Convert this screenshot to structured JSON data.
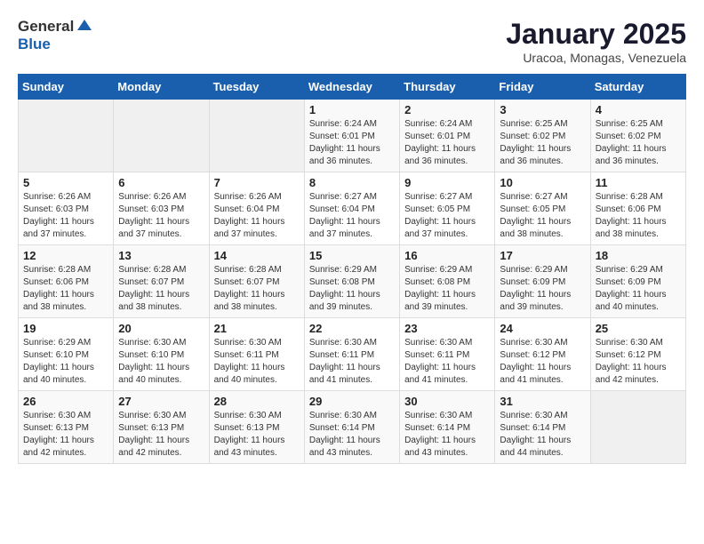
{
  "header": {
    "logo_general": "General",
    "logo_blue": "Blue",
    "month": "January 2025",
    "location": "Uracoa, Monagas, Venezuela"
  },
  "days_of_week": [
    "Sunday",
    "Monday",
    "Tuesday",
    "Wednesday",
    "Thursday",
    "Friday",
    "Saturday"
  ],
  "weeks": [
    [
      {
        "day": "",
        "info": ""
      },
      {
        "day": "",
        "info": ""
      },
      {
        "day": "",
        "info": ""
      },
      {
        "day": "1",
        "info": "Sunrise: 6:24 AM\nSunset: 6:01 PM\nDaylight: 11 hours\nand 36 minutes."
      },
      {
        "day": "2",
        "info": "Sunrise: 6:24 AM\nSunset: 6:01 PM\nDaylight: 11 hours\nand 36 minutes."
      },
      {
        "day": "3",
        "info": "Sunrise: 6:25 AM\nSunset: 6:02 PM\nDaylight: 11 hours\nand 36 minutes."
      },
      {
        "day": "4",
        "info": "Sunrise: 6:25 AM\nSunset: 6:02 PM\nDaylight: 11 hours\nand 36 minutes."
      }
    ],
    [
      {
        "day": "5",
        "info": "Sunrise: 6:26 AM\nSunset: 6:03 PM\nDaylight: 11 hours\nand 37 minutes."
      },
      {
        "day": "6",
        "info": "Sunrise: 6:26 AM\nSunset: 6:03 PM\nDaylight: 11 hours\nand 37 minutes."
      },
      {
        "day": "7",
        "info": "Sunrise: 6:26 AM\nSunset: 6:04 PM\nDaylight: 11 hours\nand 37 minutes."
      },
      {
        "day": "8",
        "info": "Sunrise: 6:27 AM\nSunset: 6:04 PM\nDaylight: 11 hours\nand 37 minutes."
      },
      {
        "day": "9",
        "info": "Sunrise: 6:27 AM\nSunset: 6:05 PM\nDaylight: 11 hours\nand 37 minutes."
      },
      {
        "day": "10",
        "info": "Sunrise: 6:27 AM\nSunset: 6:05 PM\nDaylight: 11 hours\nand 38 minutes."
      },
      {
        "day": "11",
        "info": "Sunrise: 6:28 AM\nSunset: 6:06 PM\nDaylight: 11 hours\nand 38 minutes."
      }
    ],
    [
      {
        "day": "12",
        "info": "Sunrise: 6:28 AM\nSunset: 6:06 PM\nDaylight: 11 hours\nand 38 minutes."
      },
      {
        "day": "13",
        "info": "Sunrise: 6:28 AM\nSunset: 6:07 PM\nDaylight: 11 hours\nand 38 minutes."
      },
      {
        "day": "14",
        "info": "Sunrise: 6:28 AM\nSunset: 6:07 PM\nDaylight: 11 hours\nand 38 minutes."
      },
      {
        "day": "15",
        "info": "Sunrise: 6:29 AM\nSunset: 6:08 PM\nDaylight: 11 hours\nand 39 minutes."
      },
      {
        "day": "16",
        "info": "Sunrise: 6:29 AM\nSunset: 6:08 PM\nDaylight: 11 hours\nand 39 minutes."
      },
      {
        "day": "17",
        "info": "Sunrise: 6:29 AM\nSunset: 6:09 PM\nDaylight: 11 hours\nand 39 minutes."
      },
      {
        "day": "18",
        "info": "Sunrise: 6:29 AM\nSunset: 6:09 PM\nDaylight: 11 hours\nand 40 minutes."
      }
    ],
    [
      {
        "day": "19",
        "info": "Sunrise: 6:29 AM\nSunset: 6:10 PM\nDaylight: 11 hours\nand 40 minutes."
      },
      {
        "day": "20",
        "info": "Sunrise: 6:30 AM\nSunset: 6:10 PM\nDaylight: 11 hours\nand 40 minutes."
      },
      {
        "day": "21",
        "info": "Sunrise: 6:30 AM\nSunset: 6:11 PM\nDaylight: 11 hours\nand 40 minutes."
      },
      {
        "day": "22",
        "info": "Sunrise: 6:30 AM\nSunset: 6:11 PM\nDaylight: 11 hours\nand 41 minutes."
      },
      {
        "day": "23",
        "info": "Sunrise: 6:30 AM\nSunset: 6:11 PM\nDaylight: 11 hours\nand 41 minutes."
      },
      {
        "day": "24",
        "info": "Sunrise: 6:30 AM\nSunset: 6:12 PM\nDaylight: 11 hours\nand 41 minutes."
      },
      {
        "day": "25",
        "info": "Sunrise: 6:30 AM\nSunset: 6:12 PM\nDaylight: 11 hours\nand 42 minutes."
      }
    ],
    [
      {
        "day": "26",
        "info": "Sunrise: 6:30 AM\nSunset: 6:13 PM\nDaylight: 11 hours\nand 42 minutes."
      },
      {
        "day": "27",
        "info": "Sunrise: 6:30 AM\nSunset: 6:13 PM\nDaylight: 11 hours\nand 42 minutes."
      },
      {
        "day": "28",
        "info": "Sunrise: 6:30 AM\nSunset: 6:13 PM\nDaylight: 11 hours\nand 43 minutes."
      },
      {
        "day": "29",
        "info": "Sunrise: 6:30 AM\nSunset: 6:14 PM\nDaylight: 11 hours\nand 43 minutes."
      },
      {
        "day": "30",
        "info": "Sunrise: 6:30 AM\nSunset: 6:14 PM\nDaylight: 11 hours\nand 43 minutes."
      },
      {
        "day": "31",
        "info": "Sunrise: 6:30 AM\nSunset: 6:14 PM\nDaylight: 11 hours\nand 44 minutes."
      },
      {
        "day": "",
        "info": ""
      }
    ]
  ]
}
